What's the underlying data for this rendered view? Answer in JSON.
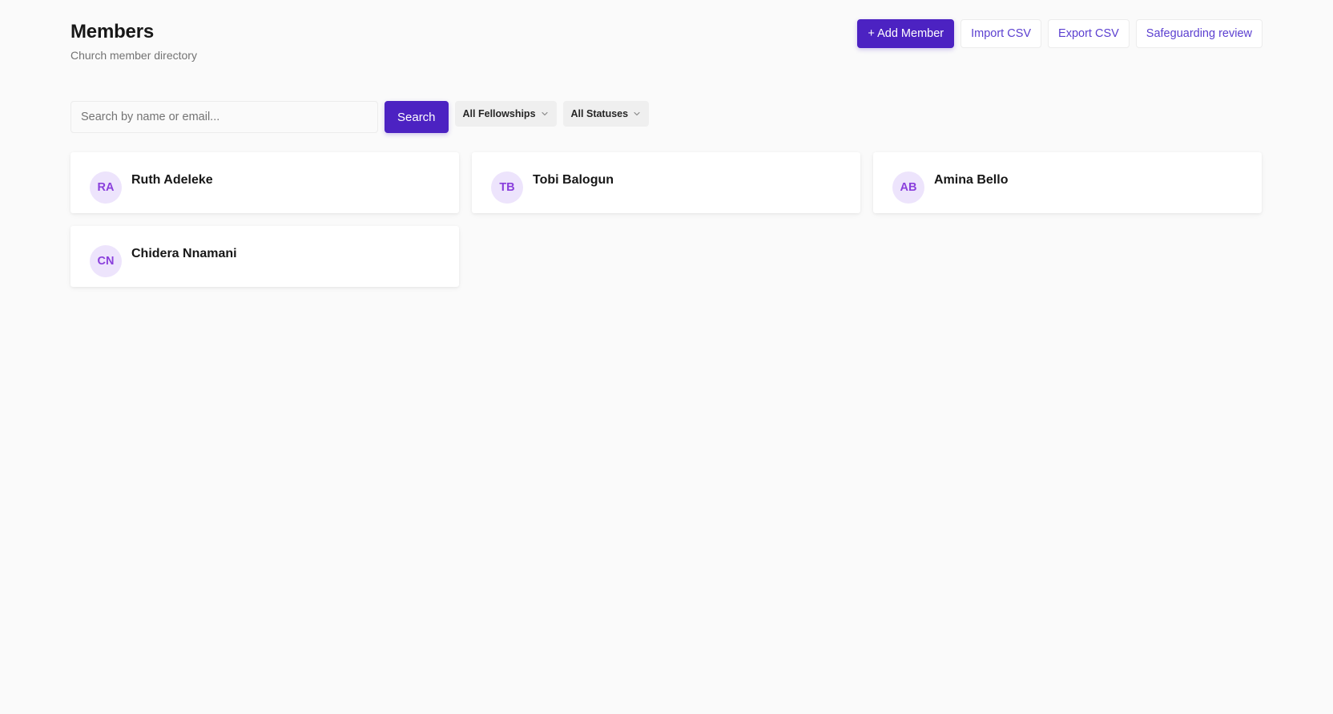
{
  "header": {
    "title": "Members",
    "subtitle": "Church member directory"
  },
  "actions": {
    "add_member": "+ Add Member",
    "import_csv": "Import CSV",
    "export_csv": "Export CSV",
    "safeguarding_review": "Safeguarding review"
  },
  "toolbar": {
    "search_placeholder": "Search by name or email...",
    "search_value": "",
    "search_button": "Search",
    "fellowship_filter": "All Fellowships",
    "status_filter": "All Statuses"
  },
  "members": [
    {
      "initials": "RA",
      "name": "Ruth Adeleke"
    },
    {
      "initials": "TB",
      "name": "Tobi Balogun"
    },
    {
      "initials": "AB",
      "name": "Amina Bello"
    },
    {
      "initials": "CN",
      "name": "Chidera Nnamani"
    }
  ],
  "icons": {
    "filter_chevron": "chevron-down-icon"
  },
  "colors": {
    "primary": "#4c22c2",
    "link": "#5b3fd0",
    "avatar_bg": "#ede4fc",
    "avatar_text": "#8a3fdc",
    "background": "#fafafa"
  }
}
